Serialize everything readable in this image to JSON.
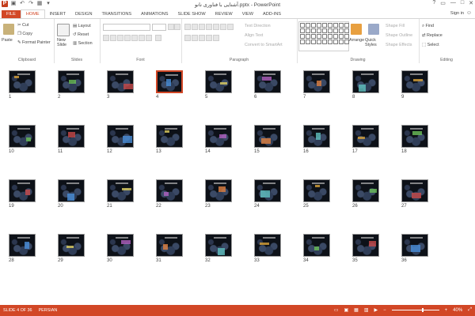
{
  "window": {
    "title": "آشنایی با فناوری نانو.pptx - PowerPoint",
    "controls": [
      "?",
      "▭",
      "—",
      "□",
      "✕"
    ]
  },
  "tabs": [
    {
      "label": "FILE"
    },
    {
      "label": "HOME"
    },
    {
      "label": "INSERT"
    },
    {
      "label": "DESIGN"
    },
    {
      "label": "TRANSITIONS"
    },
    {
      "label": "ANIMATIONS"
    },
    {
      "label": "SLIDE SHOW"
    },
    {
      "label": "REVIEW"
    },
    {
      "label": "VIEW"
    },
    {
      "label": "ADD-INS"
    }
  ],
  "signin": "Sign in",
  "ribbon": {
    "clipboard": {
      "label": "Clipboard",
      "paste": "Paste",
      "cut": "Cut",
      "copy": "Copy",
      "format_painter": "Format Painter"
    },
    "slides": {
      "label": "Slides",
      "new_slide": "New Slide",
      "layout": "Layout",
      "reset": "Reset",
      "section": "Section"
    },
    "font": {
      "label": "Font"
    },
    "paragraph": {
      "label": "Paragraph",
      "text_direction": "Text Direction",
      "align_text": "Align Text",
      "convert": "Convert to SmartArt"
    },
    "drawing": {
      "label": "Drawing",
      "arrange": "Arrange",
      "quick_styles": "Quick Styles",
      "shape_fill": "Shape Fill",
      "shape_outline": "Shape Outline",
      "shape_effects": "Shape Effects"
    },
    "editing": {
      "label": "Editing",
      "find": "Find",
      "replace": "Replace",
      "select": "Select"
    }
  },
  "slides": [
    {
      "n": "1"
    },
    {
      "n": "2"
    },
    {
      "n": "3"
    },
    {
      "n": "4",
      "selected": true
    },
    {
      "n": "5"
    },
    {
      "n": "6"
    },
    {
      "n": "7"
    },
    {
      "n": "8"
    },
    {
      "n": "9"
    },
    {
      "n": "10"
    },
    {
      "n": "11"
    },
    {
      "n": "12"
    },
    {
      "n": "13"
    },
    {
      "n": "14"
    },
    {
      "n": "15"
    },
    {
      "n": "16"
    },
    {
      "n": "17"
    },
    {
      "n": "18"
    },
    {
      "n": "19"
    },
    {
      "n": "20"
    },
    {
      "n": "21"
    },
    {
      "n": "22"
    },
    {
      "n": "23"
    },
    {
      "n": "24"
    },
    {
      "n": "25"
    },
    {
      "n": "26"
    },
    {
      "n": "27"
    },
    {
      "n": "28"
    },
    {
      "n": "29"
    },
    {
      "n": "30"
    },
    {
      "n": "31"
    },
    {
      "n": "32"
    },
    {
      "n": "33"
    },
    {
      "n": "34"
    },
    {
      "n": "35"
    },
    {
      "n": "36"
    }
  ],
  "status": {
    "slide": "SLIDE 4 OF 36",
    "language": "PERSIAN",
    "zoom": "40%",
    "zoom_minus": "−",
    "zoom_plus": "+"
  },
  "colors": {
    "accent": "#d24726"
  }
}
